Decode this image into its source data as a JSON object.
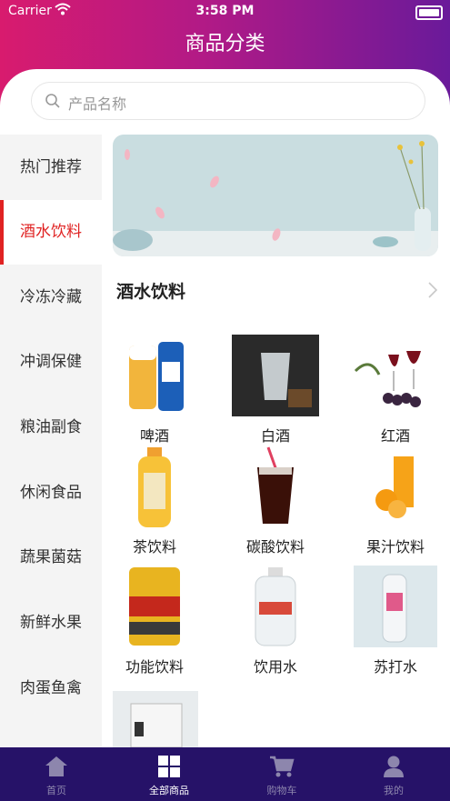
{
  "status_bar": {
    "carrier": "Carrier",
    "time": "3:58 PM"
  },
  "header": {
    "title": "商品分类"
  },
  "search": {
    "placeholder": "产品名称"
  },
  "sidebar": {
    "items": [
      {
        "label": "热门推荐"
      },
      {
        "label": "酒水饮料",
        "active": true
      },
      {
        "label": "冷冻冷藏"
      },
      {
        "label": "冲调保健"
      },
      {
        "label": "粮油副食"
      },
      {
        "label": "休闲食品"
      },
      {
        "label": "蔬果菌菇"
      },
      {
        "label": "新鲜水果"
      },
      {
        "label": "肉蛋鱼禽"
      }
    ]
  },
  "section": {
    "title": "酒水饮料"
  },
  "products": [
    {
      "name": "啤酒"
    },
    {
      "name": "白酒"
    },
    {
      "name": "红酒"
    },
    {
      "name": "茶饮料"
    },
    {
      "name": "碳酸饮料"
    },
    {
      "name": "果汁饮料"
    },
    {
      "name": "功能饮料"
    },
    {
      "name": "饮用水"
    },
    {
      "name": "苏打水"
    }
  ],
  "tabbar": {
    "items": [
      {
        "label": "首页",
        "icon": "home-icon"
      },
      {
        "label": "全部商品",
        "icon": "grid-icon",
        "active": true
      },
      {
        "label": "购物车",
        "icon": "cart-icon"
      },
      {
        "label": "我的",
        "icon": "user-icon"
      }
    ]
  },
  "colors": {
    "accent": "#e02222",
    "header_start": "#d81b6e",
    "header_end": "#6a1a9a",
    "tabbar": "#261268"
  }
}
